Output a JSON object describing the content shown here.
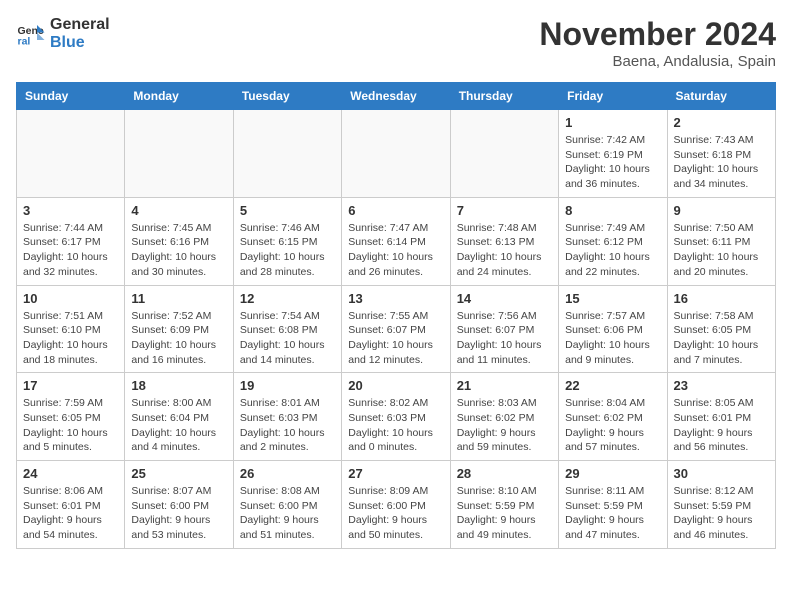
{
  "header": {
    "logo_line1": "General",
    "logo_line2": "Blue",
    "month": "November 2024",
    "location": "Baena, Andalusia, Spain"
  },
  "weekdays": [
    "Sunday",
    "Monday",
    "Tuesday",
    "Wednesday",
    "Thursday",
    "Friday",
    "Saturday"
  ],
  "weeks": [
    [
      {
        "day": "",
        "info": ""
      },
      {
        "day": "",
        "info": ""
      },
      {
        "day": "",
        "info": ""
      },
      {
        "day": "",
        "info": ""
      },
      {
        "day": "",
        "info": ""
      },
      {
        "day": "1",
        "info": "Sunrise: 7:42 AM\nSunset: 6:19 PM\nDaylight: 10 hours\nand 36 minutes."
      },
      {
        "day": "2",
        "info": "Sunrise: 7:43 AM\nSunset: 6:18 PM\nDaylight: 10 hours\nand 34 minutes."
      }
    ],
    [
      {
        "day": "3",
        "info": "Sunrise: 7:44 AM\nSunset: 6:17 PM\nDaylight: 10 hours\nand 32 minutes."
      },
      {
        "day": "4",
        "info": "Sunrise: 7:45 AM\nSunset: 6:16 PM\nDaylight: 10 hours\nand 30 minutes."
      },
      {
        "day": "5",
        "info": "Sunrise: 7:46 AM\nSunset: 6:15 PM\nDaylight: 10 hours\nand 28 minutes."
      },
      {
        "day": "6",
        "info": "Sunrise: 7:47 AM\nSunset: 6:14 PM\nDaylight: 10 hours\nand 26 minutes."
      },
      {
        "day": "7",
        "info": "Sunrise: 7:48 AM\nSunset: 6:13 PM\nDaylight: 10 hours\nand 24 minutes."
      },
      {
        "day": "8",
        "info": "Sunrise: 7:49 AM\nSunset: 6:12 PM\nDaylight: 10 hours\nand 22 minutes."
      },
      {
        "day": "9",
        "info": "Sunrise: 7:50 AM\nSunset: 6:11 PM\nDaylight: 10 hours\nand 20 minutes."
      }
    ],
    [
      {
        "day": "10",
        "info": "Sunrise: 7:51 AM\nSunset: 6:10 PM\nDaylight: 10 hours\nand 18 minutes."
      },
      {
        "day": "11",
        "info": "Sunrise: 7:52 AM\nSunset: 6:09 PM\nDaylight: 10 hours\nand 16 minutes."
      },
      {
        "day": "12",
        "info": "Sunrise: 7:54 AM\nSunset: 6:08 PM\nDaylight: 10 hours\nand 14 minutes."
      },
      {
        "day": "13",
        "info": "Sunrise: 7:55 AM\nSunset: 6:07 PM\nDaylight: 10 hours\nand 12 minutes."
      },
      {
        "day": "14",
        "info": "Sunrise: 7:56 AM\nSunset: 6:07 PM\nDaylight: 10 hours\nand 11 minutes."
      },
      {
        "day": "15",
        "info": "Sunrise: 7:57 AM\nSunset: 6:06 PM\nDaylight: 10 hours\nand 9 minutes."
      },
      {
        "day": "16",
        "info": "Sunrise: 7:58 AM\nSunset: 6:05 PM\nDaylight: 10 hours\nand 7 minutes."
      }
    ],
    [
      {
        "day": "17",
        "info": "Sunrise: 7:59 AM\nSunset: 6:05 PM\nDaylight: 10 hours\nand 5 minutes."
      },
      {
        "day": "18",
        "info": "Sunrise: 8:00 AM\nSunset: 6:04 PM\nDaylight: 10 hours\nand 4 minutes."
      },
      {
        "day": "19",
        "info": "Sunrise: 8:01 AM\nSunset: 6:03 PM\nDaylight: 10 hours\nand 2 minutes."
      },
      {
        "day": "20",
        "info": "Sunrise: 8:02 AM\nSunset: 6:03 PM\nDaylight: 10 hours\nand 0 minutes."
      },
      {
        "day": "21",
        "info": "Sunrise: 8:03 AM\nSunset: 6:02 PM\nDaylight: 9 hours\nand 59 minutes."
      },
      {
        "day": "22",
        "info": "Sunrise: 8:04 AM\nSunset: 6:02 PM\nDaylight: 9 hours\nand 57 minutes."
      },
      {
        "day": "23",
        "info": "Sunrise: 8:05 AM\nSunset: 6:01 PM\nDaylight: 9 hours\nand 56 minutes."
      }
    ],
    [
      {
        "day": "24",
        "info": "Sunrise: 8:06 AM\nSunset: 6:01 PM\nDaylight: 9 hours\nand 54 minutes."
      },
      {
        "day": "25",
        "info": "Sunrise: 8:07 AM\nSunset: 6:00 PM\nDaylight: 9 hours\nand 53 minutes."
      },
      {
        "day": "26",
        "info": "Sunrise: 8:08 AM\nSunset: 6:00 PM\nDaylight: 9 hours\nand 51 minutes."
      },
      {
        "day": "27",
        "info": "Sunrise: 8:09 AM\nSunset: 6:00 PM\nDaylight: 9 hours\nand 50 minutes."
      },
      {
        "day": "28",
        "info": "Sunrise: 8:10 AM\nSunset: 5:59 PM\nDaylight: 9 hours\nand 49 minutes."
      },
      {
        "day": "29",
        "info": "Sunrise: 8:11 AM\nSunset: 5:59 PM\nDaylight: 9 hours\nand 47 minutes."
      },
      {
        "day": "30",
        "info": "Sunrise: 8:12 AM\nSunset: 5:59 PM\nDaylight: 9 hours\nand 46 minutes."
      }
    ]
  ]
}
